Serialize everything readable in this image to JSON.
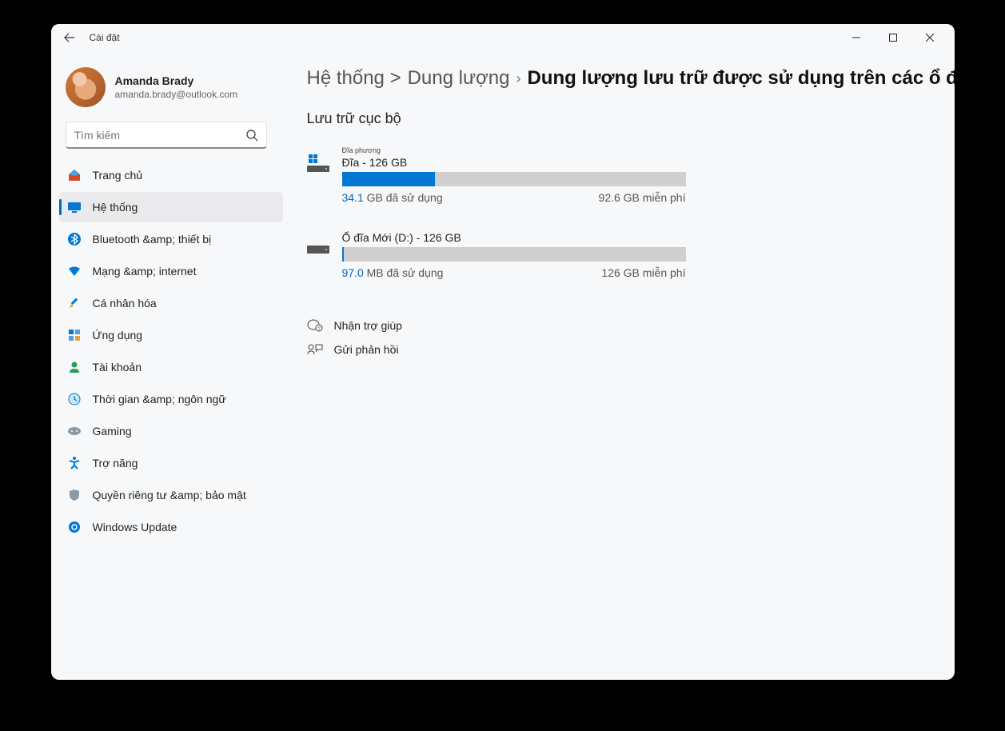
{
  "titlebar": {
    "title": "Cài đặt"
  },
  "profile": {
    "name": "Amanda Brady",
    "email": "amanda.brady@outlook.com"
  },
  "search": {
    "placeholder": "Tìm kiếm"
  },
  "nav": {
    "items": [
      {
        "id": "home",
        "label": "Trang chủ"
      },
      {
        "id": "system",
        "label": "Hệ thống"
      },
      {
        "id": "bluetooth",
        "label": "Bluetooth &amp; thiết bị"
      },
      {
        "id": "network",
        "label": "Mạng &amp; internet"
      },
      {
        "id": "personal",
        "label": "Cá nhân hóa"
      },
      {
        "id": "apps",
        "label": "Ứng dụng"
      },
      {
        "id": "accounts",
        "label": "Tài khoản"
      },
      {
        "id": "time",
        "label": "Thời gian &amp; ngôn ngữ"
      },
      {
        "id": "gaming",
        "label": "Gaming"
      },
      {
        "id": "access",
        "label": "Trợ năng"
      },
      {
        "id": "privacy",
        "label": "Quyền riêng tư &amp; bảo mật"
      },
      {
        "id": "update",
        "label": "Windows Update"
      }
    ]
  },
  "breadcrumb": {
    "crumb1": "Hệ thống >",
    "crumb2": "Dung lượng",
    "current": "Dung lượng lưu trữ được sử dụng trên các ổ đĩa khác"
  },
  "section": {
    "title": "Lưu trữ cục bộ"
  },
  "drives": [
    {
      "smallLabel": "Đĩa phương",
      "title": "Đĩa - 126 GB",
      "usedVal": "34.1",
      "usedUnit": "GB đã sử dụng",
      "freeVal": "92.6",
      "freeUnit": "GB miễn phí",
      "percent": 27,
      "isSystem": true
    },
    {
      "smallLabel": "",
      "title": "Ổ đĩa Mới (D:) - 126 GB",
      "usedVal": "97.0",
      "usedUnit": "MB đã sử dụng",
      "freeVal": "126",
      "freeUnit": "GB miễn phí",
      "percent": 0,
      "isSystem": false
    }
  ],
  "help": {
    "getHelp": "Nhận trợ giúp",
    "feedback": "Gửi phản hồi"
  }
}
